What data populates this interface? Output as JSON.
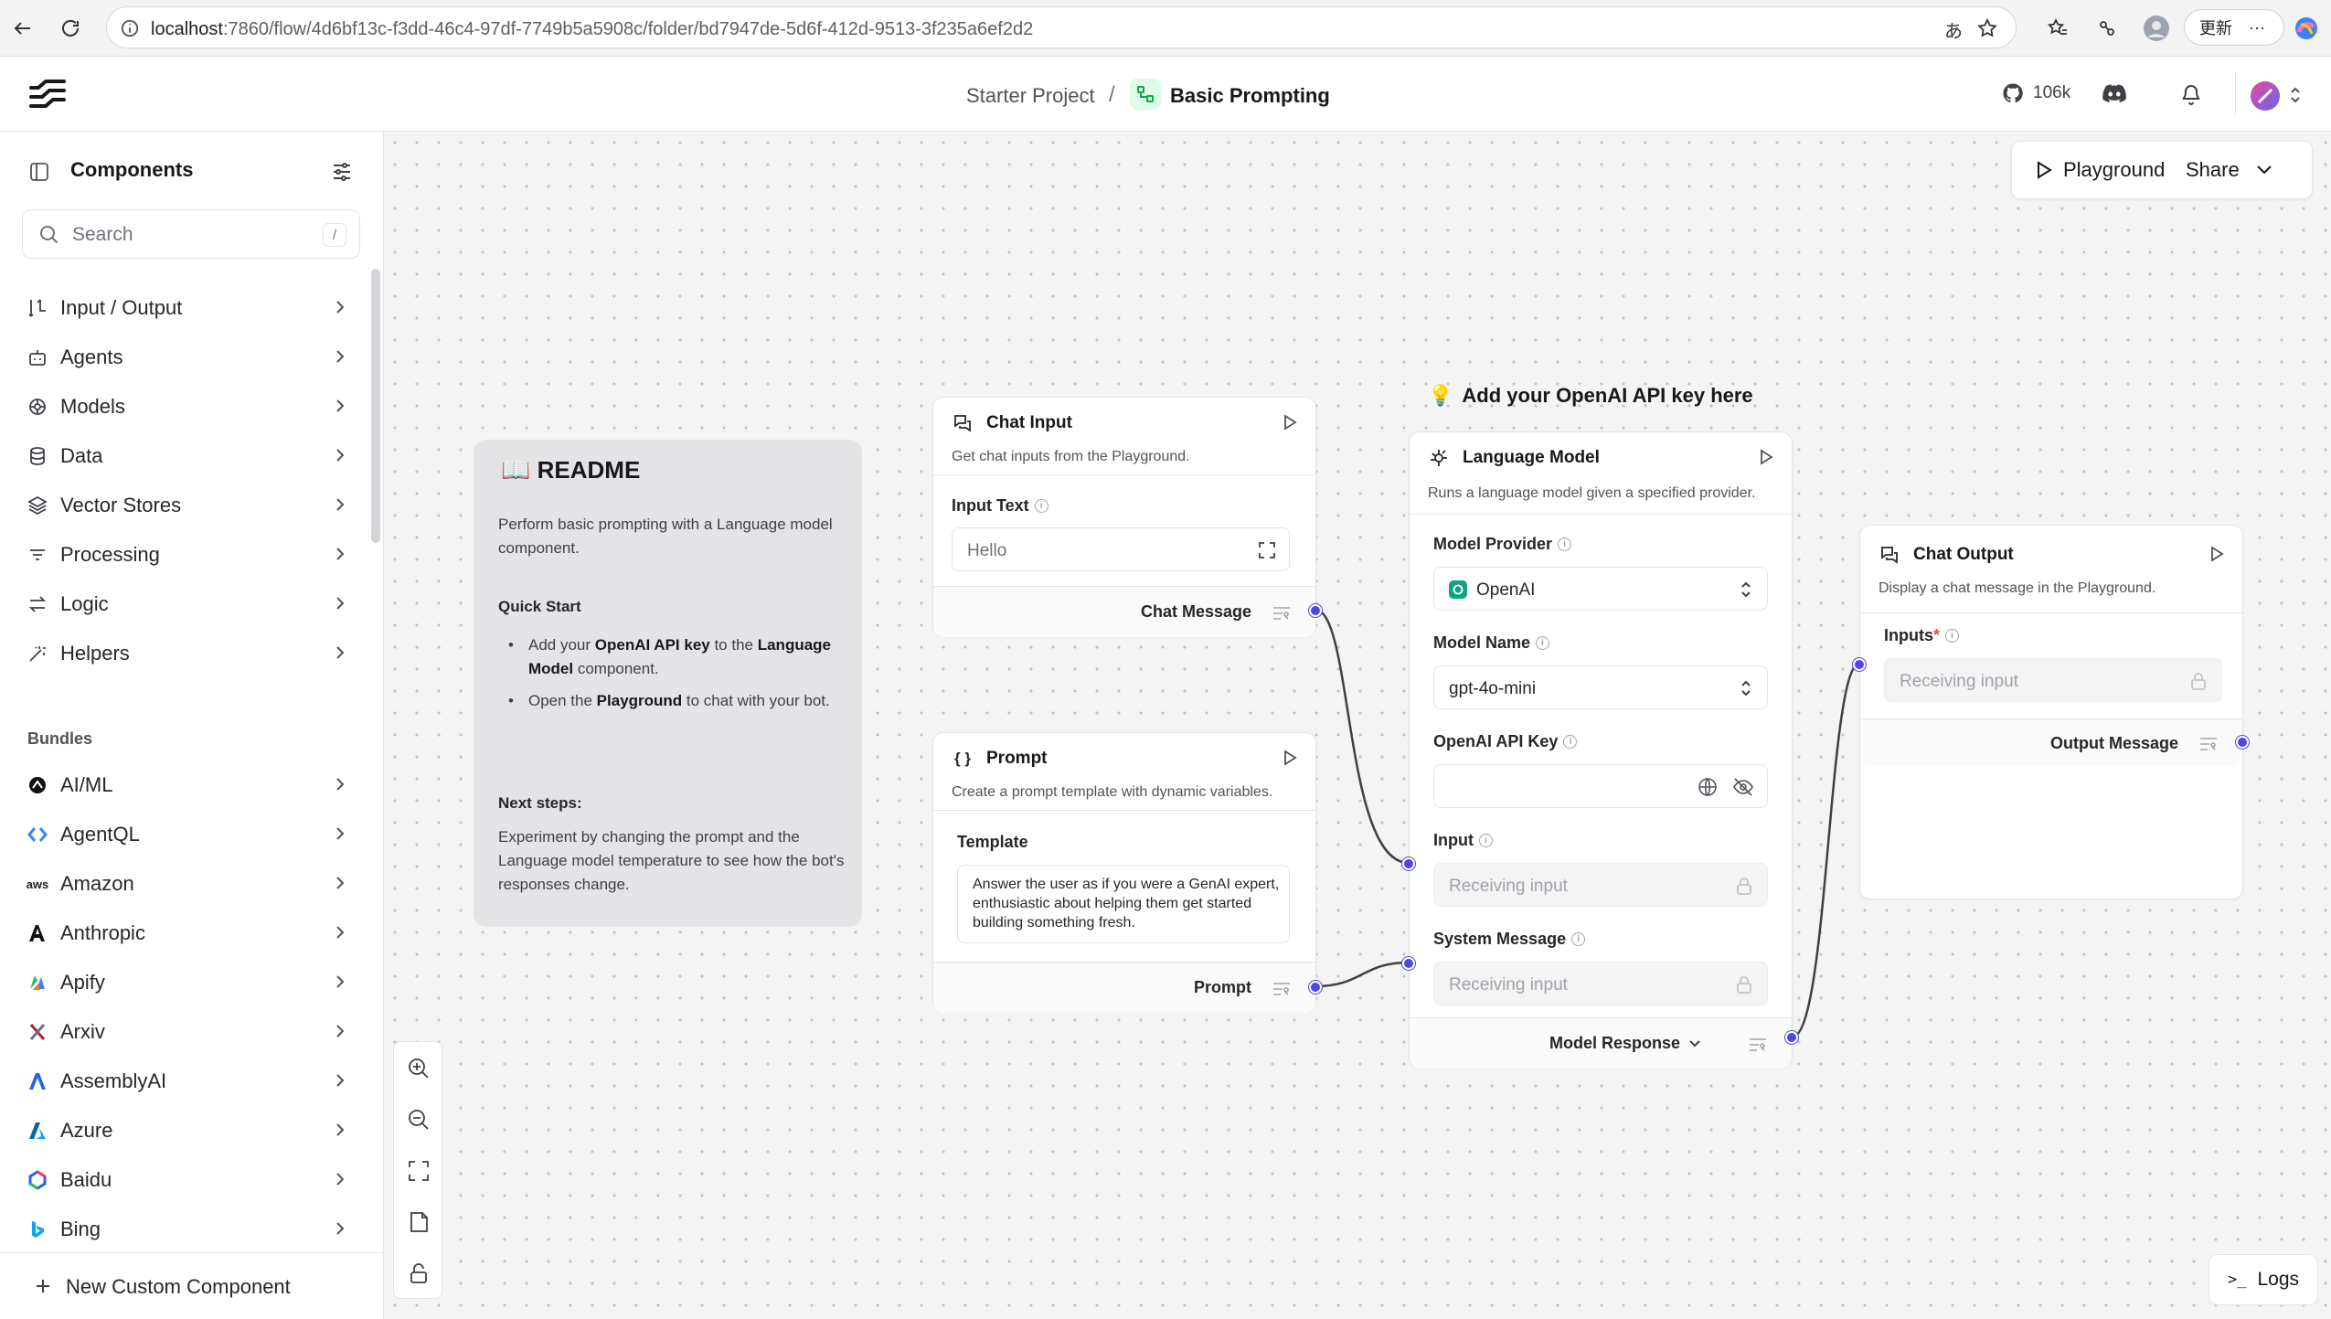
{
  "browser": {
    "url_host": "localhost",
    "url_rest": ":7860/flow/4d6bf13c-f3dd-46c4-97df-7749b5a5908c/folder/bd7947de-5d6f-412d-9513-3f235a6ef2d2",
    "translate_glyph": "あ",
    "update_label": "更新",
    "more_label": "···"
  },
  "header": {
    "project": "Starter Project",
    "separator": "/",
    "flow_name": "Basic Prompting",
    "github_stars": "106k"
  },
  "sidebar": {
    "title": "Components",
    "search_placeholder": "Search",
    "search_shortcut": "/",
    "categories": [
      {
        "label": "Input / Output",
        "icon": "io-icon"
      },
      {
        "label": "Agents",
        "icon": "bot-icon"
      },
      {
        "label": "Models",
        "icon": "brain-icon"
      },
      {
        "label": "Data",
        "icon": "database-icon"
      },
      {
        "label": "Vector Stores",
        "icon": "layers-icon"
      },
      {
        "label": "Processing",
        "icon": "list-filter-icon"
      },
      {
        "label": "Logic",
        "icon": "arrows-icon"
      },
      {
        "label": "Helpers",
        "icon": "wand-icon"
      }
    ],
    "bundles_heading": "Bundles",
    "bundles": [
      {
        "label": "AI/ML",
        "color": "#111111"
      },
      {
        "label": "AgentQL",
        "color": "#3b82f6"
      },
      {
        "label": "Amazon",
        "color": "#f59e0b"
      },
      {
        "label": "Anthropic",
        "color": "#111111"
      },
      {
        "label": "Apify",
        "color": "#22c55e"
      },
      {
        "label": "Arxiv",
        "color": "#b91c1c"
      },
      {
        "label": "AssemblyAI",
        "color": "#2563eb"
      },
      {
        "label": "Azure",
        "color": "#0078d4"
      },
      {
        "label": "Baidu",
        "color": "#2563eb"
      },
      {
        "label": "Bing",
        "color": "#0ea5e9"
      }
    ],
    "new_component": "New Custom Component",
    "aws_text": "aws"
  },
  "canvas": {
    "playground": "Playground",
    "share": "Share",
    "logs": "Logs",
    "logs_prompt": ">_",
    "note": "Add your OpenAI API key here",
    "readme": {
      "title": "README",
      "intro": "Perform basic prompting with a Language model component.",
      "quick_start": "Quick Start",
      "item1_a": "Add your ",
      "item1_b": "OpenAI API key",
      "item1_c": " to the ",
      "item1_d": "Language Model",
      "item1_e": " component.",
      "item2_a": "Open the ",
      "item2_b": "Playground",
      "item2_c": " to chat with your bot.",
      "next_steps": "Next steps:",
      "next_text": "Experiment by changing the prompt and the Language model temperature to see how the bot's responses change."
    },
    "chat_input": {
      "title": "Chat Input",
      "desc": "Get chat inputs from the Playground.",
      "field_label": "Input Text",
      "field_value": "Hello",
      "output": "Chat Message"
    },
    "prompt": {
      "title": "Prompt",
      "icon_text": "{ }",
      "desc": "Create a prompt template with dynamic variables.",
      "field_label": "Template",
      "template": "Answer the user as if you were a GenAI expert, enthusiastic about helping them get started building something fresh.",
      "output": "Prompt"
    },
    "language_model": {
      "title": "Language Model",
      "desc": "Runs a language model given a specified provider.",
      "provider_label": "Model Provider",
      "provider_value": "OpenAI",
      "model_label": "Model Name",
      "model_value": "gpt-4o-mini",
      "api_key_label": "OpenAI API Key",
      "api_key_value": "",
      "input_label": "Input",
      "input_placeholder": "Receiving input",
      "system_label": "System Message",
      "system_placeholder": "Receiving input",
      "output": "Model Response"
    },
    "chat_output": {
      "title": "Chat Output",
      "desc": "Display a chat message in the Playground.",
      "inputs_label": "Inputs",
      "required_mark": "*",
      "inputs_placeholder": "Receiving input",
      "output": "Output Message"
    }
  }
}
